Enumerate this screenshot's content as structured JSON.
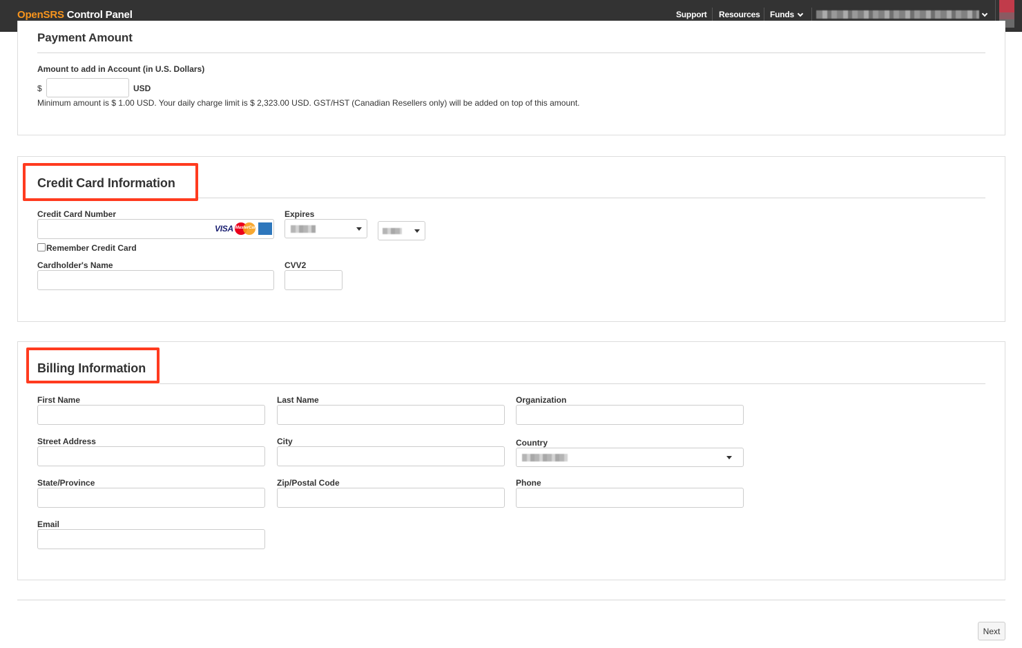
{
  "header": {
    "brand_part1": "OpenSRS",
    "brand_part2": " Control Panel",
    "nav": {
      "support": "Support",
      "resources": "Resources",
      "funds": "Funds"
    },
    "brand_color": "#f7941d",
    "bar_color": "#333333"
  },
  "payment": {
    "title": "Payment Amount",
    "amount_label": "Amount to add in Account (in U.S. Dollars)",
    "currency_symbol": "$",
    "currency_code": "USD",
    "amount_value": "",
    "note": "Minimum amount is $ 1.00 USD. Your daily charge limit is $ 2,323.00 USD. GST/HST (Canadian Resellers only) will be added on top of this amount."
  },
  "credit_card": {
    "title": "Credit Card Information",
    "number_label": "Credit Card Number",
    "number_value": "",
    "card_brands": {
      "visa": "VISA",
      "mastercard": "MasterCard",
      "amex": "AMERICAN EXPRESS"
    },
    "expires_label": "Expires",
    "remember_label": "Remember Credit Card",
    "remember_checked": false,
    "cardholder_label": "Cardholder's Name",
    "cardholder_value": "",
    "cvv_label": "CVV2",
    "cvv_value": ""
  },
  "billing": {
    "title": "Billing Information",
    "labels": {
      "first_name": "First Name",
      "last_name": "Last Name",
      "organization": "Organization",
      "street": "Street Address",
      "city": "City",
      "country": "Country",
      "state": "State/Province",
      "zip": "Zip/Postal Code",
      "phone": "Phone",
      "email": "Email"
    }
  },
  "actions": {
    "next": "Next"
  },
  "highlight_color": "#ff3b1f"
}
